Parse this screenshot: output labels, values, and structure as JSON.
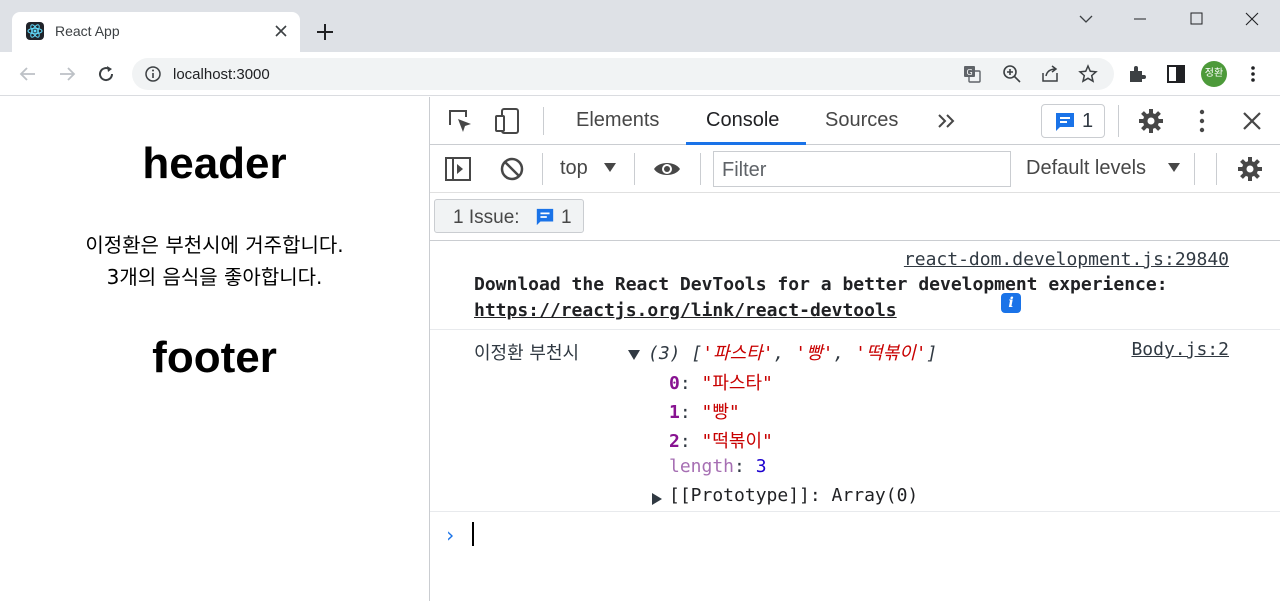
{
  "browser": {
    "tab_title": "React App",
    "url": "localhost:3000",
    "profile_initials": "정환"
  },
  "page": {
    "header": "header",
    "line1": "이정환은 부천시에 거주합니다.",
    "line2": "3개의 음식을 좋아합니다.",
    "footer": "footer"
  },
  "devtools": {
    "tabs": [
      "Elements",
      "Console",
      "Sources"
    ],
    "active_tab": "Console",
    "issue_count": "1",
    "context": "top",
    "filter_placeholder": "Filter",
    "levels": "Default levels",
    "issues_label": "1 Issue:",
    "issues_count": "1",
    "accent": "#1a73e8"
  },
  "console": {
    "msg1": {
      "source": "react-dom.development.js:29840",
      "text": "Download the React DevTools for a better development experience:",
      "link": "https://reactjs.org/link/react-devtools"
    },
    "msg2": {
      "source": "Body.js:2",
      "prefix": "이정환 부천시",
      "array_len": "(3)",
      "items": [
        "'파스타'",
        "'빵'",
        "'떡볶이'"
      ],
      "expanded": [
        {
          "key": "0",
          "value": "\"파스타\""
        },
        {
          "key": "1",
          "value": "\"빵\""
        },
        {
          "key": "2",
          "value": "\"떡볶이\""
        }
      ],
      "length_key": "length",
      "length_val": "3",
      "prototype": "[[Prototype]]: Array(0)"
    }
  }
}
